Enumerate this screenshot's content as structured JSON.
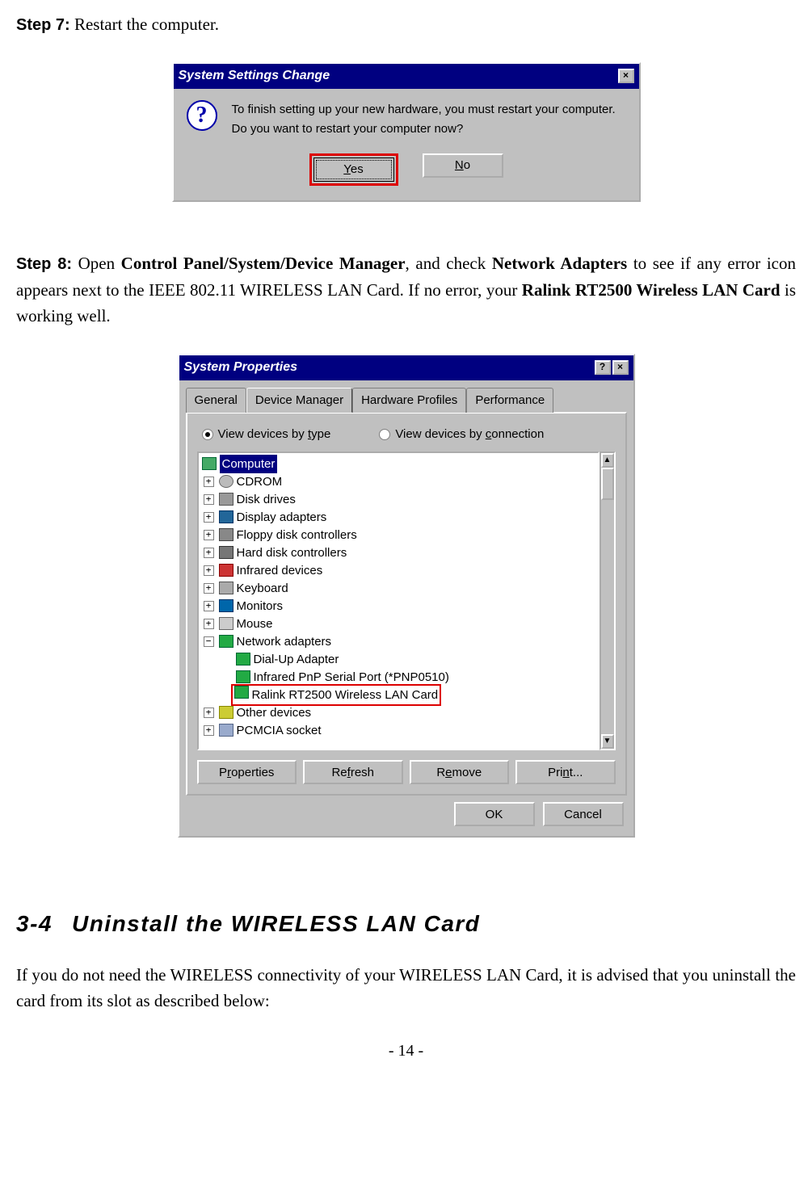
{
  "step7": {
    "label": "Step 7:",
    "text": " Restart the computer."
  },
  "dialog1": {
    "title": "System Settings Change",
    "close": "×",
    "msg1": "To finish setting up your new hardware, you must restart your computer.",
    "msg2": "Do you want to restart your computer now?",
    "yes_u": "Y",
    "yes_rest": "es",
    "no_u": "N",
    "no_rest": "o"
  },
  "step8": {
    "label": "Step 8:",
    "t1": " Open ",
    "b1": "Control Panel/System/Device Manager",
    "t2": ", and check ",
    "b2": "Network Adapters",
    "t3": " to see if any error icon appears next to the IEEE 802.11 WIRELESS LAN Card. If no error, your ",
    "b3": "Ralink RT2500 Wireless LAN Card",
    "t4": " is working well."
  },
  "dialog2": {
    "title": "System Properties",
    "help": "?",
    "close": "×",
    "tabs": [
      "General",
      "Device Manager",
      "Hardware Profiles",
      "Performance"
    ],
    "radio1": "View devices by type",
    "radio1_u": "t",
    "radio2": "View devices by connection",
    "radio2_u": "c",
    "tree": {
      "root": "Computer",
      "items": [
        "CDROM",
        "Disk drives",
        "Display adapters",
        "Floppy disk controllers",
        "Hard disk controllers",
        "Infrared devices",
        "Keyboard",
        "Monitors",
        "Mouse",
        "Network adapters",
        "Other devices",
        "PCMCIA socket"
      ],
      "net_children": [
        "Dial-Up Adapter",
        "Infrared PnP Serial Port (*PNP0510)",
        "Ralink RT2500 Wireless LAN Card"
      ]
    },
    "btns": {
      "prop_u": "r",
      "prop_rest": "P",
      "prop_tail": "operties",
      "ref_u": "f",
      "ref_pre": "Re",
      "ref_tail": "resh",
      "rem_u": "e",
      "rem_pre": "R",
      "rem_tail": "move",
      "prn_u": "n",
      "prn_pre": "Pri",
      "prn_tail": "t..."
    },
    "ok": "OK",
    "cancel": "Cancel"
  },
  "section": {
    "num": "3-4",
    "title": "Uninstall the WIRELESS LAN Card"
  },
  "para": "If you do not need the WIRELESS connectivity of your WIRELESS LAN Card, it is advised that you uninstall the card from its slot as described below:",
  "page": "- 14 -"
}
